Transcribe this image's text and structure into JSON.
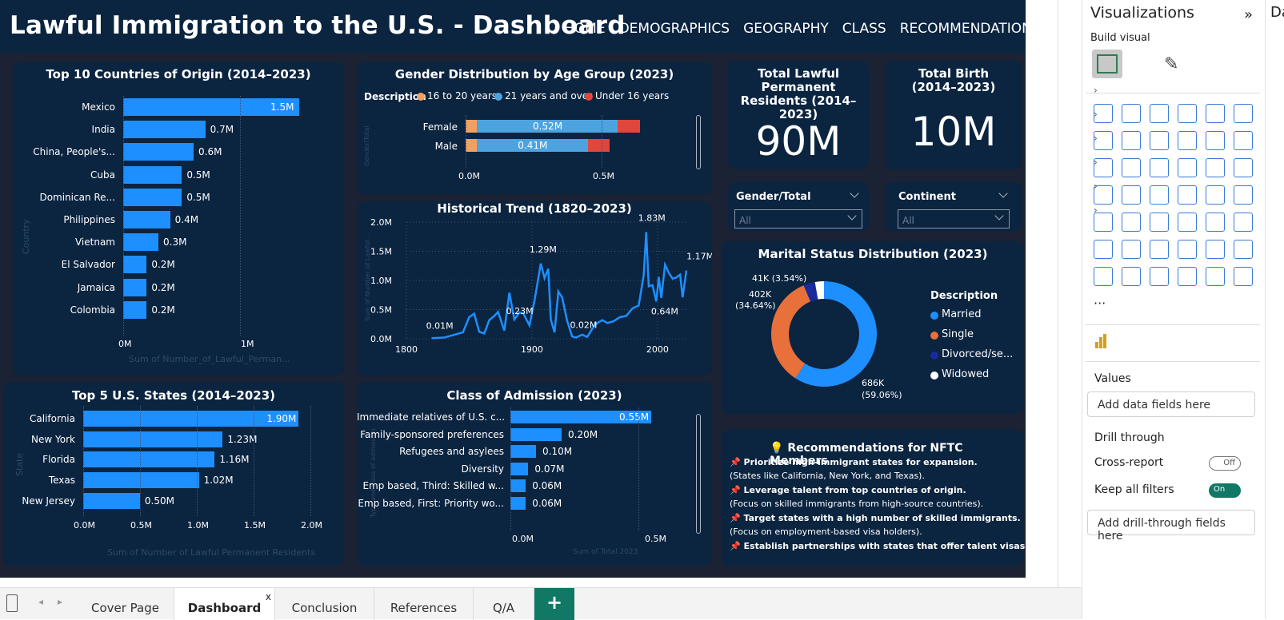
{
  "header": {
    "title": "Lawful Immigration to the U.S. - Dashboard",
    "nav": [
      "HOME",
      "DEMOGRAPHICS",
      "GEOGRAPHY",
      "CLASS",
      "RECOMMENDATIONS"
    ]
  },
  "countries": {
    "title": "Top 10 Countries of Origin (2014–2023)",
    "ylabel": "Country",
    "xlabel": "Sum of Number_of_Lawful_Perman...",
    "ticks": [
      "0M",
      "1M"
    ],
    "chart_data": {
      "type": "bar",
      "categories": [
        "Mexico",
        "India",
        "China, People's...",
        "Cuba",
        "Dominican Re...",
        "Philippines",
        "Vietnam",
        "El Salvador",
        "Jamaica",
        "Colombia"
      ],
      "values": [
        1.5,
        0.7,
        0.6,
        0.5,
        0.5,
        0.4,
        0.3,
        0.2,
        0.2,
        0.2
      ],
      "labels": [
        "1.5M",
        "0.7M",
        "0.6M",
        "0.5M",
        "0.5M",
        "0.4M",
        "0.3M",
        "0.2M",
        "0.2M",
        "0.2M"
      ],
      "xlim": [
        0,
        1.5
      ]
    }
  },
  "states": {
    "title": "Top 5 U.S. States (2014–2023)",
    "ylabel": "State",
    "xlabel": "Sum of Number of Lawful Permanent Residents",
    "ticks": [
      "0.0M",
      "0.5M",
      "1.0M",
      "1.5M",
      "2.0M"
    ],
    "chart_data": {
      "type": "bar",
      "categories": [
        "California",
        "New York",
        "Florida",
        "Texas",
        "New Jersey"
      ],
      "values": [
        1.9,
        1.23,
        1.16,
        1.02,
        0.5
      ],
      "labels": [
        "1.90M",
        "1.23M",
        "1.16M",
        "1.02M",
        "0.50M"
      ],
      "xlim": [
        0,
        2.0
      ]
    }
  },
  "gender": {
    "title": "Gender Distribution by Age Group (2023)",
    "legend_title": "Description",
    "ylabel": "Gender/Total",
    "ticks": [
      "0.0M",
      "0.5M"
    ],
    "chart_data": {
      "type": "bar",
      "stacked": true,
      "categories": [
        "Female",
        "Male"
      ],
      "series": [
        {
          "name": "16 to 20 years",
          "values": [
            0.04,
            0.04
          ],
          "color": "#f0a060"
        },
        {
          "name": "21 years and over",
          "values": [
            0.52,
            0.41
          ],
          "color": "#4da3e0"
        },
        {
          "name": "Under 16 years",
          "values": [
            0.08,
            0.08
          ],
          "color": "#e0463c"
        }
      ],
      "labels": [
        "0.52M",
        "0.41M"
      ],
      "xlim": [
        0,
        0.65
      ]
    }
  },
  "trend": {
    "title": "Historical Trend (1820–2023)",
    "ylabel": "Sum of Number of Lawful...",
    "yticks": [
      "2.0M",
      "1.5M",
      "1.0M",
      "0.5M",
      "0.0M"
    ],
    "xticks": [
      "1800",
      "1900",
      "2000"
    ],
    "annotations": [
      "0.01M",
      "1.29M",
      "0.23M",
      "0.02M",
      "1.83M",
      "1.17M",
      "0.64M"
    ],
    "chart_data": {
      "type": "line",
      "xlim": [
        1800,
        2023
      ],
      "ylim": [
        0,
        2.0
      ],
      "x": [
        1820,
        1830,
        1840,
        1845,
        1850,
        1854,
        1858,
        1862,
        1866,
        1870,
        1873,
        1878,
        1882,
        1886,
        1890,
        1893,
        1898,
        1902,
        1905,
        1907,
        1910,
        1913,
        1915,
        1918,
        1921,
        1924,
        1928,
        1932,
        1935,
        1940,
        1944,
        1948,
        1952,
        1956,
        1960,
        1965,
        1970,
        1975,
        1980,
        1985,
        1989,
        1991,
        1993,
        1996,
        1999,
        2001,
        2003,
        2006,
        2009,
        2012,
        2015,
        2018,
        2020,
        2023
      ],
      "y": [
        0.01,
        0.02,
        0.08,
        0.11,
        0.37,
        0.43,
        0.12,
        0.09,
        0.32,
        0.39,
        0.46,
        0.14,
        0.79,
        0.33,
        0.45,
        0.44,
        0.23,
        0.65,
        1.03,
        1.29,
        1.04,
        1.2,
        0.33,
        0.11,
        0.81,
        0.71,
        0.31,
        0.04,
        0.02,
        0.07,
        0.03,
        0.17,
        0.27,
        0.32,
        0.27,
        0.3,
        0.37,
        0.39,
        0.52,
        0.57,
        1.09,
        1.83,
        0.9,
        0.92,
        0.64,
        1.06,
        0.7,
        1.27,
        1.13,
        1.03,
        1.05,
        1.1,
        0.71,
        1.17
      ],
      "color": "#1e8fff"
    }
  },
  "admission": {
    "title": "Class of Admission (2023)",
    "ylabel": "Type and class of admission",
    "xlabel": "Sum of Total 2023",
    "ticks": [
      "0.0M",
      "0.5M"
    ],
    "chart_data": {
      "type": "bar",
      "categories": [
        "Immediate relatives of U.S. c...",
        "Family-sponsored preferences",
        "Refugees and asylees",
        "Diversity",
        "Emp based, Third: Skilled w...",
        "Emp based, First: Priority wo..."
      ],
      "values": [
        0.55,
        0.2,
        0.1,
        0.07,
        0.06,
        0.06
      ],
      "labels": [
        "0.55M",
        "0.20M",
        "0.10M",
        "0.07M",
        "0.06M",
        "0.06M"
      ],
      "xlim": [
        0,
        0.55
      ]
    }
  },
  "kpi1": {
    "title": "Total Lawful Permanent Residents (2014–2023)",
    "value": "90M"
  },
  "kpi2": {
    "title": "Total Birth (2014–2023)",
    "value": "10M"
  },
  "slicer1": {
    "title": "Gender/Total",
    "value": "All"
  },
  "slicer2": {
    "title": "Continent",
    "value": "All"
  },
  "marital": {
    "title": "Marital Status Distribution (2023)",
    "legend_title": "Description",
    "labels": [
      "41K (3.54%)",
      "402K",
      "(34.64%)",
      "686K",
      "(59.06%)"
    ],
    "chart_data": {
      "type": "pie",
      "donut": true,
      "categories": [
        "Married",
        "Single",
        "Divorced/se...",
        "Widowed"
      ],
      "values": [
        686,
        402,
        41,
        32
      ],
      "colors": [
        "#1e8fff",
        "#e8703a",
        "#1a2a9c",
        "#ffffff"
      ]
    }
  },
  "recommendations": {
    "title": "Recommendations for NFTC Members",
    "items": [
      {
        "head": "Prioritize high-immigrant states for expansion.",
        "sub": "(States like California, New York, and Texas)."
      },
      {
        "head": "Leverage talent from top countries of origin.",
        "sub": "(Focus on skilled immigrants from high-source countries)."
      },
      {
        "head": "Target states with a high number of skilled immigrants.",
        "sub": "(Focus on employment-based visa holders)."
      },
      {
        "head": "Establish partnerships with states that offer talent visas.",
        "sub": ""
      }
    ]
  },
  "pane": {
    "title": "Visualizations",
    "build_visual": "Build visual",
    "values_label": "Values",
    "values_placeholder": "Add data fields here",
    "drill_label": "Drill through",
    "cross_report": "Cross-report",
    "cross_report_state": "Off",
    "keep_filters": "Keep all filters",
    "keep_filters_state": "On",
    "drill_placeholder": "Add drill-through fields here",
    "far_title": "Da"
  },
  "tabs": [
    "Cover Page",
    "Dashboard",
    "Conclusion",
    "References",
    "Q/A"
  ],
  "active_tab": "Dashboard",
  "tab_close": "x",
  "add_tab": "+"
}
